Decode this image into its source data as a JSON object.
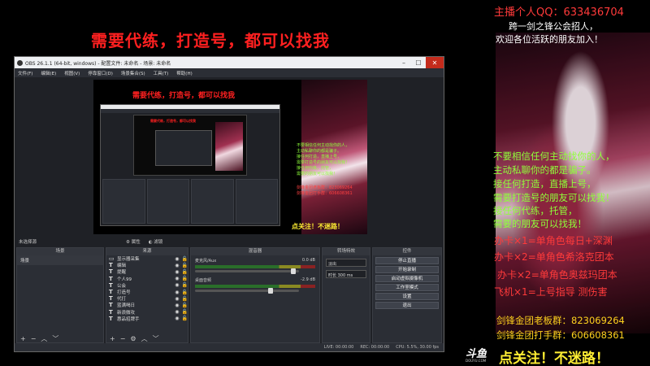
{
  "headline": "需要代练，打造号，都可以找我",
  "obs": {
    "title": "OBS 26.1.1 (64-bit, windows) - 配置文件: 未命名 - 场景: 未命名",
    "menu": [
      "文件(F)",
      "编辑(E)",
      "视图(V)",
      "停靠窗口(D)",
      "场景集合(S)",
      "工具(T)",
      "帮助(H)"
    ],
    "preview": {
      "headline": "需要代练，打造号，都可以找我",
      "green_lines": [
        "不要相信任何主动找你的人，",
        "主动私聊你的都是骗子。",
        "接任何打造，直播上号，",
        "需要打造号的朋友可以找我！",
        "接任何代练，托管，",
        "需要的朋友可以找我！"
      ],
      "red_lines": [
        "剑锋金团老板群：823069264",
        "剑锋金团打手群：606608361"
      ],
      "follow": "点关注！不迷路！"
    },
    "studio_label": "未选择源",
    "studio_tabs": [
      "属性",
      "滤镜"
    ],
    "scenes": {
      "header": "场景",
      "items": [
        "场景"
      ]
    },
    "sources": {
      "header": "来源",
      "items": [
        "显示器采集",
        "编辑",
        "提醒",
        "个人99",
        "公会",
        "打造号",
        "代打",
        "蓝满喝日",
        "新浪微攻",
        "惠品招牌手"
      ]
    },
    "mixer": {
      "header": "混音器",
      "channels": [
        {
          "name": "麦克风/Aux",
          "db": "0.0 dB"
        },
        {
          "name": "桌面音频",
          "db": "-2.9 dB"
        }
      ]
    },
    "transitions": {
      "header": "转场特效",
      "type": "淡出",
      "duration_label": "时长",
      "duration": "300 ms"
    },
    "controls": {
      "header": "控件",
      "buttons": [
        "停止直播",
        "开始录制",
        "启动虚拟摄像机",
        "工作室模式",
        "设置",
        "退出"
      ]
    },
    "status": {
      "live": "LIVE: 00:00:00",
      "rec": "REC: 00:00:00",
      "cpu": "CPU: 5.5%, 30.00 fps"
    }
  },
  "overlay": {
    "host": "主播个人QQ：633436704",
    "guild_lines": [
      "跨一剑之锋公会招人，",
      "欢迎各位活跃的朋友加入！"
    ],
    "green_lines": [
      "不要相信任何主动找你的人，",
      "主动私聊你的都是骗子。",
      "接任何打造，直播上号，",
      "需要打造号的朋友可以找我！",
      "接任何代练，托管，",
      "需要的朋友可以找我！"
    ],
    "red_lines": [
      "办卡×1=单角色每日+深渊",
      "办卡×2=单角色希洛克团本",
      "办卡×2=单角色奥兹玛团本",
      "飞机×1=上号指导 测伤害"
    ],
    "yellow_lines": [
      "剑锋金团老板群：823069264",
      "剑锋金团打手群：606608361"
    ],
    "logo": "斗鱼",
    "logo_sub": "DOUYU.COM",
    "follow": "点关注！不迷路！"
  }
}
